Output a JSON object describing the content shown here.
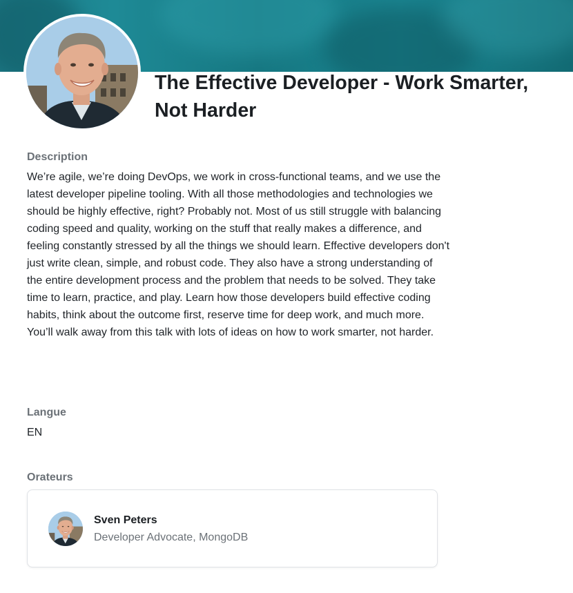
{
  "session": {
    "title": "The Effective Developer - Work Smarter, Not Harder"
  },
  "description": {
    "label": "Description",
    "text": "We’re agile, we’re doing DevOps, we work in cross-functional teams, and we use the latest developer pipeline tooling. With all those methodologies and technologies we should be highly effective, right? Probably not. Most of us still struggle with balancing coding speed and quality, working on the stuff that really makes a difference, and feeling constantly stressed by all the things we should learn. Effective developers don't just write clean, simple, and robust code. They also have a strong understanding of the entire development process and the problem that needs to be solved. They take time to learn, practice, and play. Learn how those developers build effective coding habits, think about the outcome first, reserve time for deep work, and much more. You’ll walk away from this talk with lots of ideas on how to work smarter, not harder."
  },
  "language": {
    "label": "Langue",
    "value": "EN"
  },
  "speakers": {
    "label": "Orateurs",
    "items": [
      {
        "name": "Sven Peters",
        "role": "Developer Advocate, MongoDB",
        "avatar_icon": "speaker-photo"
      }
    ]
  },
  "banner": {
    "accent_color": "#1e8a96"
  }
}
